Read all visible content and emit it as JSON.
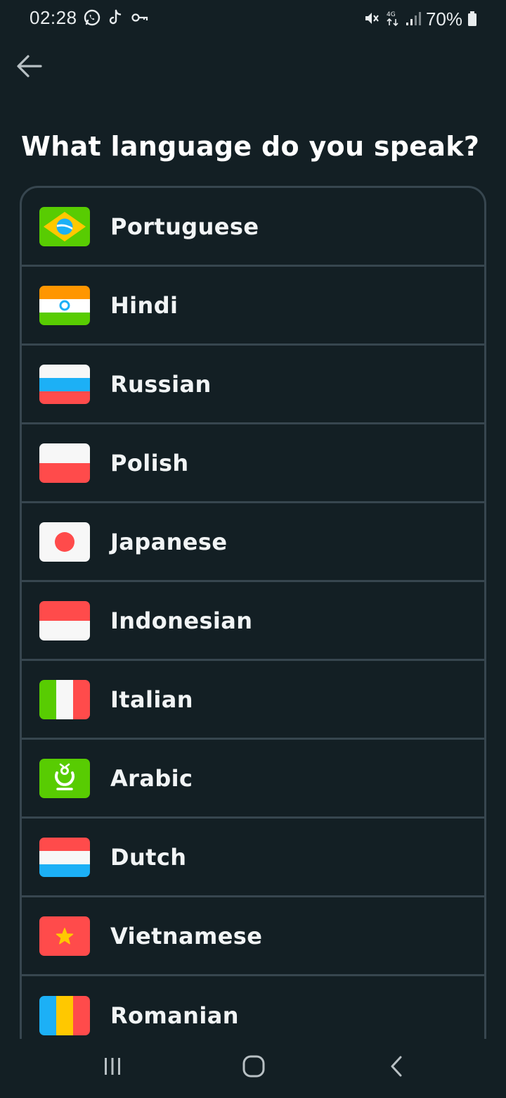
{
  "status_bar": {
    "time": "02:28",
    "battery": "70%",
    "left_icons": [
      "whatsapp-icon",
      "tiktok-icon",
      "key-icon"
    ],
    "right_icons": [
      "mute-icon",
      "4g-data-icon",
      "signal-icon",
      "battery-icon"
    ]
  },
  "header": {
    "back_icon": "arrow-left-icon",
    "title": "What language do you speak?"
  },
  "languages": [
    {
      "label": "Portuguese",
      "flag": "brazil-flag-icon"
    },
    {
      "label": "Hindi",
      "flag": "india-flag-icon"
    },
    {
      "label": "Russian",
      "flag": "russia-flag-icon"
    },
    {
      "label": "Polish",
      "flag": "poland-flag-icon"
    },
    {
      "label": "Japanese",
      "flag": "japan-flag-icon"
    },
    {
      "label": "Indonesian",
      "flag": "indonesia-flag-icon"
    },
    {
      "label": "Italian",
      "flag": "italy-flag-icon"
    },
    {
      "label": "Arabic",
      "flag": "arabic-flag-icon"
    },
    {
      "label": "Dutch",
      "flag": "netherlands-flag-icon"
    },
    {
      "label": "Vietnamese",
      "flag": "vietnam-flag-icon"
    },
    {
      "label": "Romanian",
      "flag": "romania-flag-icon"
    }
  ],
  "nav_bar": {
    "recents_icon": "recent-apps-icon",
    "home_icon": "home-icon",
    "back_icon": "back-chevron-icon"
  },
  "colors": {
    "background": "#131f24",
    "border": "#37464f",
    "text": "#ffffff"
  }
}
